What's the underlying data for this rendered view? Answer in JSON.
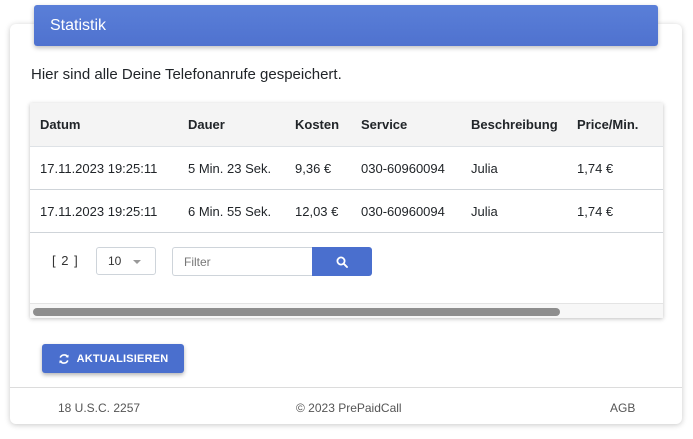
{
  "header": {
    "title": "Statistik"
  },
  "intro_text": "Hier sind alle Deine Telefonanrufe gespeichert.",
  "table": {
    "columns": [
      "Datum",
      "Dauer",
      "Kosten",
      "Service",
      "Beschreibung",
      "Price/Min."
    ],
    "rows": [
      [
        "17.11.2023 19:25:11",
        "5 Min. 23 Sek.",
        "9,36 €",
        "030-60960094",
        "Julia",
        "1,74 €"
      ],
      [
        "17.11.2023 19:25:11",
        "6 Min. 55 Sek.",
        "12,03 €",
        "030-60960094",
        "Julia",
        "1,74 €"
      ]
    ]
  },
  "pagination": {
    "label": "[ 2 ]"
  },
  "page_size": {
    "selected": "10"
  },
  "filter": {
    "placeholder": "Filter"
  },
  "refresh_button": {
    "label": "AKTUALISIEREN"
  },
  "footer": {
    "left": "18 U.S.C. 2257",
    "center": "© 2023 PrePaidCall",
    "right": "AGB"
  },
  "colors": {
    "accent": "#4a6fce",
    "header_gradient_top": "#5a7fd8"
  },
  "icons": {
    "search": "search-icon",
    "refresh": "refresh-icon",
    "select": "chevron-down-icon"
  }
}
